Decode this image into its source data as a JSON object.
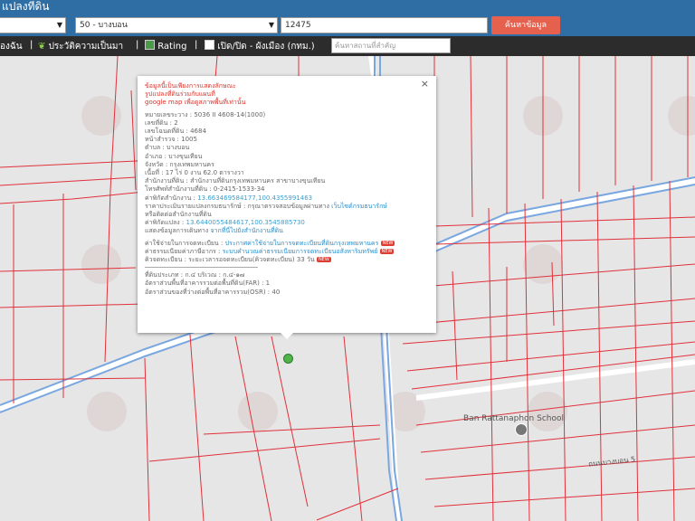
{
  "header": {
    "title": "แปลงที่ดิน",
    "province_select": "",
    "district_select": "50 - บางบอน",
    "parcel_number": "12475",
    "search_button": "ค้นหาข้อมูล"
  },
  "toolbar": {
    "item1": "องฉัน",
    "sep": "|",
    "item2": "ประวัติความเป็นมา",
    "item3": "Rating",
    "item4": "เปิด/ปิด - ผังเมือง (กทม.)",
    "place_search_placeholder": "ค้นหาสถานที่สำคัญ"
  },
  "popup": {
    "close": "×",
    "warning": [
      "ข้อมูลนี้เป็นเพียงการแสดงลักษณะ",
      "รูปแปลงที่ดินร่วมกับแผนที่",
      "google map เพื่อดูสภาพพื้นที่เท่านั้น"
    ],
    "lines": [
      "หมายเลขระวาง : 5036 II 4608-14(1000)",
      "เลขที่ดิน : 2",
      "เลขโฉนดที่ดิน : 4684",
      "หน้าสำรวจ : 1005",
      "ตำบล : บางบอน",
      "อำเภอ : บางขุนเทียน",
      "จังหวัด : กรุงเทพมหานคร",
      "เนื้อที่ : 17 ไร่ 0 งาน 62.0 ตารางวา",
      "สำนักงานที่ดิน : สำนักงานที่ดินกรุงเทพมหานคร สาขาบางขุนเทียน",
      "โทรศัพท์สำนักงานที่ดิน : 0-2415-1533-34"
    ],
    "office_coord_label": "ค่าพิกัดสำนักงาน : ",
    "office_coord": "13.663469584177,100.4355991463",
    "price_line_a": "ราคาประเมินรายแปลงกรมธนารักษ์ : กรุณาตรวจสอบข้อมูลผ่านทาง ",
    "price_link": "เว็บไซต์กรมธนารักษ์",
    "price_line_b": "หรือติดต่อสำนักงานที่ดิน",
    "parcel_coord_label": "ค่าพิกัดแปลง : ",
    "parcel_coord": "13.6440055484617,100.3545885730",
    "directions_label": "แสดงข้อมูลการเดินทาง ",
    "directions_link": "จากที่นี่ไปยังสำนักงานที่ดิน",
    "fee_label": "ค่าใช้จ่ายในการจดทะเบียน : ",
    "fee_link": "ประกาศค่าใช้จ่ายในการจดทะเบียนที่ดินกรุงเทพมหานคร",
    "tax_label": "ค่าธรรมเนียมค่าภาษีอากร : ",
    "tax_link": "ระบบคำนวณค่าธรรมเนียมการจดทะเบียนอสังหาริมทรัพย์",
    "queue_line": "คิวจดทะเบียน : ระยะเวลารอจดทะเบียน(คิวจดทะเบียน) 33 วัน",
    "badge": "NEW",
    "zoning": "ที่ดินประเภท : ก.๔ บริเวณ : ก.๔-๑๗",
    "far": "อัตราส่วนพื้นที่อาคารรวมต่อพื้นที่ดิน(FAR) : 1",
    "osr": "อัตราส่วนของที่ว่างต่อพื้นที่อาคารรวม(OSR) : 40"
  },
  "map": {
    "school": "Ban Rattanaphon School",
    "road": "ถนนบางบอน 5"
  }
}
